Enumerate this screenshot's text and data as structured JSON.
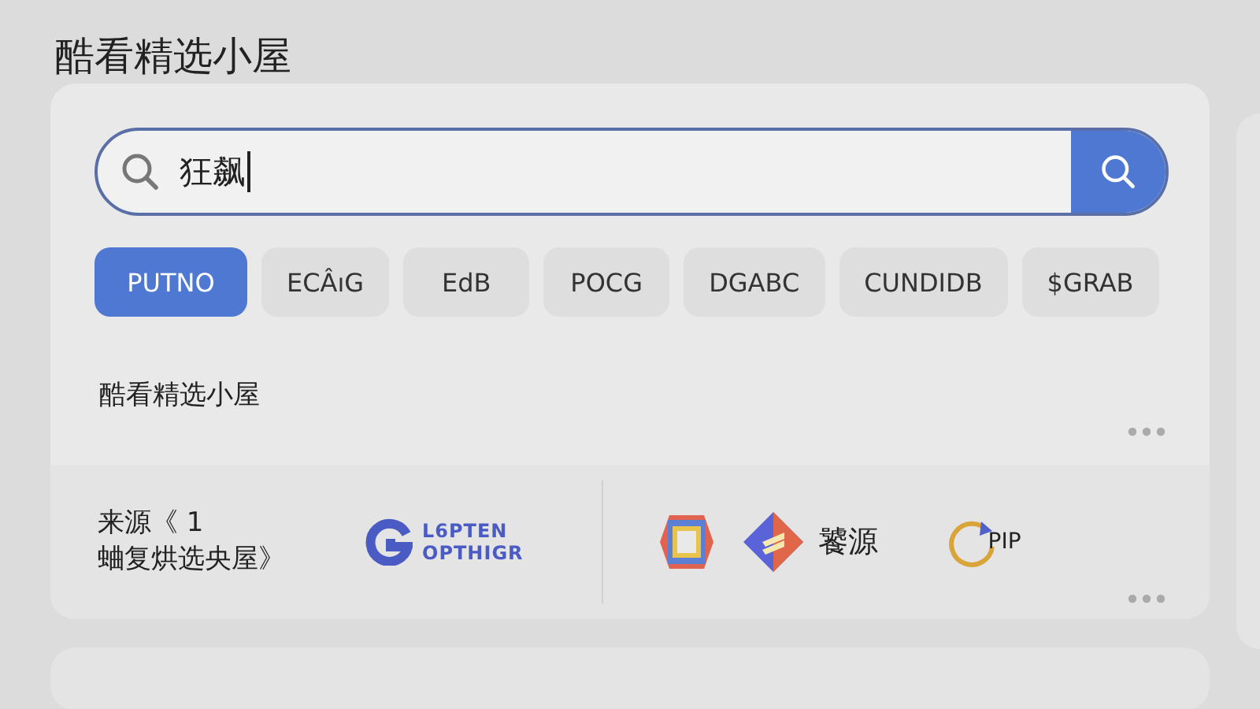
{
  "title": "酷看精选小屋",
  "search": {
    "value": "狂飙"
  },
  "filters": [
    {
      "label": "PUTNO",
      "selected": true
    },
    {
      "label": "ECÂıG",
      "selected": false
    },
    {
      "label": "EdB",
      "selected": false
    },
    {
      "label": "POCG",
      "selected": false
    },
    {
      "label": "DGABC",
      "selected": false
    },
    {
      "label": "CUNDIDB",
      "selected": false
    },
    {
      "label": "$GRAB",
      "selected": false
    }
  ],
  "section": {
    "title": "酷看精选小屋"
  },
  "sources": {
    "caption_lines": [
      "来源《 1",
      "蛐复烘选央屋》"
    ],
    "items": [
      {
        "kind": "wordmark",
        "lines": [
          "L6PTEN",
          "OPTHIGR"
        ]
      },
      {
        "kind": "frame"
      },
      {
        "kind": "diamond",
        "label": "饕源"
      },
      {
        "kind": "ring",
        "label": "PIP"
      }
    ]
  }
}
